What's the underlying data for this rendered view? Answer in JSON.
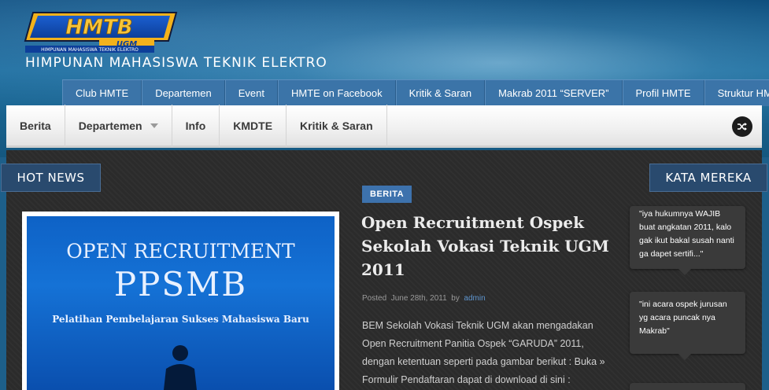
{
  "site": {
    "logo_text": "HMTE",
    "logo_sub": "UGM",
    "logo_tagline": "HIMPUNAN MAHASISWA TEKNIK ELEKTRO",
    "subtitle": "HIMPUNAN MAHASISWA TEKNIK ELEKTRO"
  },
  "top_nav": [
    "Club HMTE",
    "Departemen",
    "Event",
    "HMTE on Facebook",
    "Kritik & Saran",
    "Makrab 2011 “SERVER”",
    "Profil HMTE",
    "Struktur HMTE"
  ],
  "sub_nav": {
    "items": [
      "Berita",
      "Departemen",
      "Info",
      "KMDTE",
      "Kritik & Saran"
    ],
    "shuffle_icon": "shuffle-icon"
  },
  "hot_news": {
    "label": "HOT NEWS",
    "image": {
      "line1": "OPEN RECRUITMENT",
      "line2": "PPSMB",
      "line3": "Pelatihan Pembelajaran Sukses Mahasiswa Baru"
    }
  },
  "article": {
    "category": "BERITA",
    "title": "Open Recruitment Ospek Sekolah Vokasi Teknik UGM 2011",
    "meta_posted": "Posted",
    "meta_date": "June 28th, 2011",
    "meta_by": "by",
    "meta_author": "admin",
    "excerpt": "BEM Sekolah Vokasi Teknik UGM akan mengadakan Open Recruitment Panitia Ospek “GARUDA” 2011, dengan ketentuan seperti pada gambar berikut : Buka » Formulir Pendaftaran dapat di download di sini :"
  },
  "kata_mereka": {
    "label": "KATA MEREKA",
    "quotes": [
      "\"iya hukumnya WAJIB buat angkatan 2011, kalo gak ikut bakal susah nanti ga dapet sertifi...\"",
      "\"ini acara ospek jurusan yg acara puncak nya Makrab\""
    ]
  },
  "colors": {
    "top_nav_bg": "#3b74a8",
    "ribbon_bg": "#294a6e",
    "badge_bg": "#3d72ad",
    "content_bg": "#2b2b2b"
  }
}
